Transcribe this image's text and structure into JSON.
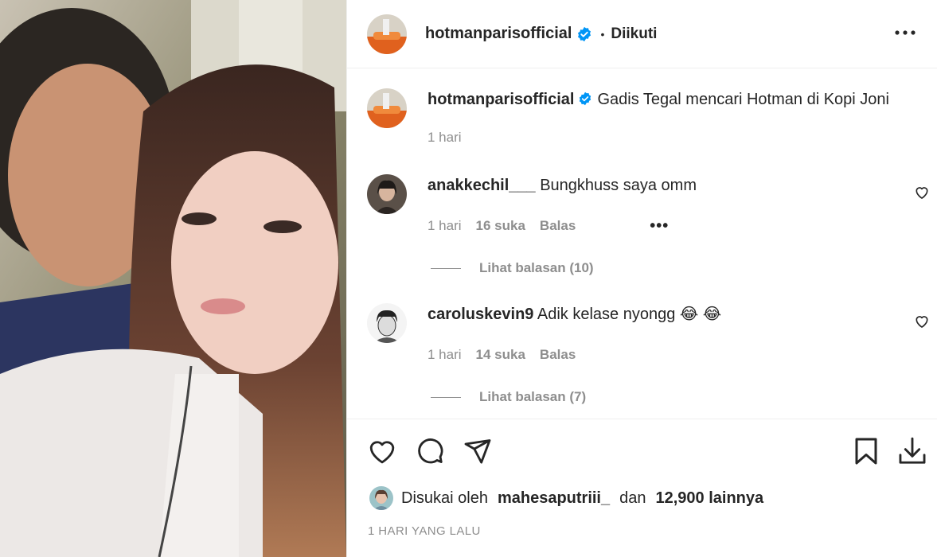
{
  "post": {
    "username": "hotmanparisofficial",
    "follow_status": "Diikuti",
    "separator": "•"
  },
  "caption": {
    "username": "hotmanparisofficial",
    "text": "Gadis Tegal mencari Hotman di Kopi Joni",
    "time": "1 hari"
  },
  "comments": [
    {
      "username": "anakkechil___",
      "text": "Bungkhuss saya omm",
      "time": "1 hari",
      "likes": "16 suka",
      "reply_label": "Balas",
      "view_replies": "Lihat balasan (10)"
    },
    {
      "username": "caroluskevin9",
      "text": "Adik kelase nyongg 😂 😂",
      "time": "1 hari",
      "likes": "14 suka",
      "reply_label": "Balas",
      "view_replies": "Lihat balasan (7)"
    }
  ],
  "footer": {
    "liked_by_prefix": "Disukai oleh",
    "liked_by_user": "mahesaputriii_",
    "and": "dan",
    "others": "12,900 lainnya",
    "date": "1 HARI YANG LALU"
  },
  "icons": {
    "verified": "verified-badge-icon",
    "more": "more-options-icon",
    "like": "heart-icon",
    "comment": "comment-icon",
    "share": "share-icon",
    "save": "bookmark-icon",
    "download": "download-icon"
  },
  "colors": {
    "verified_blue": "#0095f6",
    "text": "#262626",
    "muted": "#8e8e8e"
  }
}
